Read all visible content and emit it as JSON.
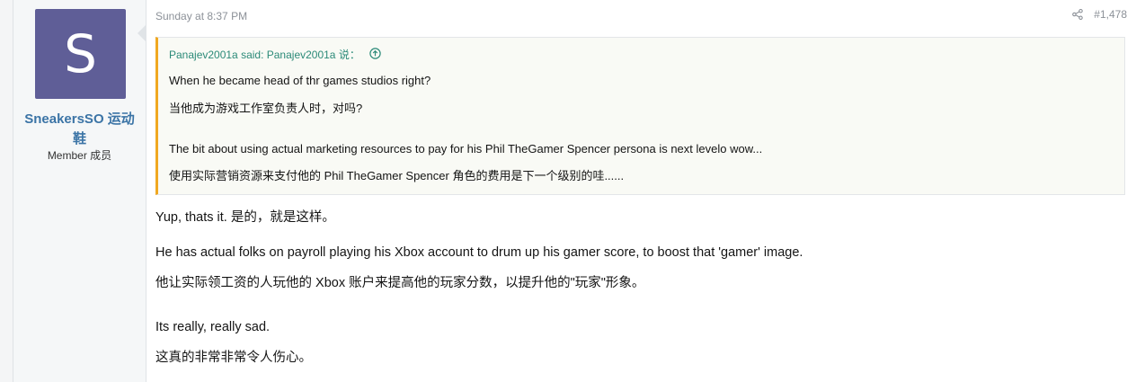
{
  "user": {
    "avatar_letter": "S",
    "name": "SneakersSO 运动鞋",
    "title": "Member 成员"
  },
  "post": {
    "timestamp": "Sunday at 8:37 PM",
    "number": "#1,478"
  },
  "quote": {
    "header": "Panajev2001a said:  Panajev2001a 说：",
    "lines": [
      "When he became head of thr games studios right?",
      "当他成为游戏工作室负责人时，对吗?",
      "The bit about using actual marketing resources to pay for his Phil TheGamer Spencer persona is next levelo wow...",
      "使用实际营销资源来支付他的 Phil TheGamer Spencer 角色的费用是下一个级别的哇......"
    ]
  },
  "body": {
    "lines": [
      "Yup, thats it.  是的，就是这样。",
      "He has actual folks on payroll playing his Xbox account to drum up his gamer score, to boost that 'gamer' image.",
      "他让实际领工资的人玩他的 Xbox 账户来提高他的玩家分数，以提升他的\"玩家\"形象。",
      "Its really, really sad.",
      "这真的非常非常令人伤心。"
    ]
  },
  "colors": {
    "avatar_bg": "#5f5e97",
    "username": "#3b74a6",
    "quote_border": "#f0a821",
    "quote_header": "#2b8a78"
  }
}
